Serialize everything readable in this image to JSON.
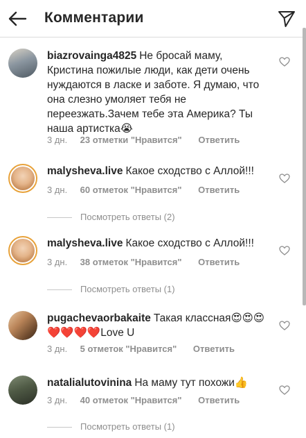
{
  "header": {
    "title": "Комментарии",
    "back_icon": "arrow-left-icon",
    "share_icon": "paper-plane-icon"
  },
  "comments": [
    {
      "username": "biazrovainga4825",
      "text": "Не бросай маму, Кристина пожилые люди, как дети очень нуждаются в ласке и заботе. Я думаю, что она слезно умоляет тебя не переезжать.Зачем тебе эта Америка? Ты наша артистка",
      "emoji": "😭",
      "time": "3 дн.",
      "likes": "23 отметки \"Нравится\"",
      "reply": "Ответить"
    },
    {
      "username": "malysheva.live",
      "text": "Какое сходство с Аллой!!!",
      "time": "3 дн.",
      "likes": "60 отметок \"Нравится\"",
      "reply": "Ответить",
      "view_replies": "Посмотреть ответы (2)"
    },
    {
      "username": "malysheva.live",
      "text": "Какое сходство с Аллой!!!",
      "time": "3 дн.",
      "likes": "38 отметок \"Нравится\"",
      "reply": "Ответить",
      "view_replies": "Посмотреть ответы (1)"
    },
    {
      "username": "pugachevaorbakaite",
      "text": "Такая классная",
      "emoji": "😍😍😍❤️❤️❤️❤️",
      "text_end": "Love U",
      "time": "3 дн.",
      "likes": "5 отметок \"Нравится\"",
      "reply": "Ответить"
    },
    {
      "username": "natalialutovinina",
      "text": "На маму тут похожи",
      "emoji": "👍",
      "time": "3 дн.",
      "likes": "40 отметок \"Нравится\"",
      "reply": "Ответить",
      "view_replies": "Посмотреть ответы (1)"
    }
  ],
  "colors": {
    "ring": "#e8a23a",
    "heart_red": "#ed4956",
    "meta_gray": "#8e8e8e"
  }
}
